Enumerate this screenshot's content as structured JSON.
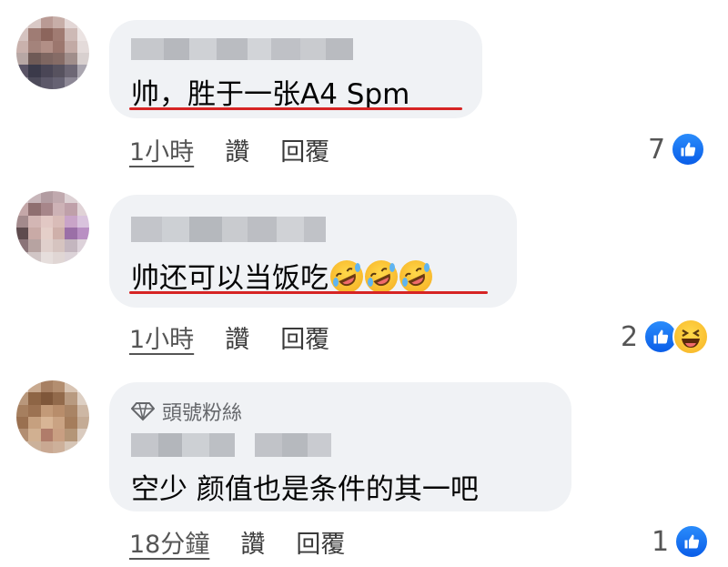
{
  "comments": [
    {
      "text": "帅，胜于一张A4 Spm",
      "time": "1小時",
      "like": "讚",
      "reply": "回覆",
      "reaction_count": "7",
      "reactions": [
        "like-icon"
      ]
    },
    {
      "text": "帅还可以当饭吃",
      "emoji": [
        "rolling-on-floor-laughing",
        "rolling-on-floor-laughing",
        "rolling-on-floor-laughing"
      ],
      "time": "1小時",
      "like": "讚",
      "reply": "回覆",
      "reaction_count": "2",
      "reactions": [
        "like-icon",
        "haha-icon"
      ]
    },
    {
      "badge": "頭號粉絲",
      "text": "空少 颜值也是条件的其一吧",
      "time": "18分鐘",
      "like": "讚",
      "reply": "回覆",
      "reaction_count": "1",
      "reactions": [
        "like-icon"
      ]
    }
  ],
  "colors": {
    "bubble": "#f0f2f5",
    "underline": "#d62424",
    "like": "#1877f2"
  }
}
